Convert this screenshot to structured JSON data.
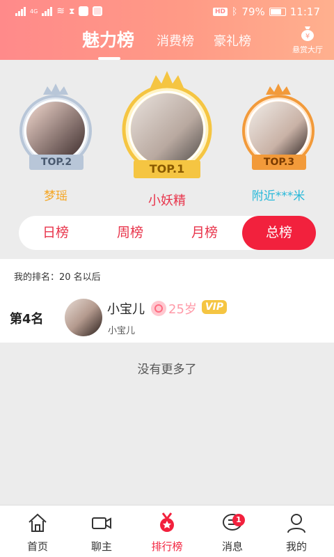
{
  "status_bar": {
    "network": "4G",
    "battery": "79%",
    "time": "11:17",
    "hd": "HD"
  },
  "header": {
    "tabs": [
      {
        "label": "魅力榜",
        "active": true
      },
      {
        "label": "消费榜",
        "active": false
      },
      {
        "label": "豪礼榜",
        "active": false
      }
    ],
    "reward_hall": "悬赏大厅"
  },
  "podium": [
    {
      "rank_label": "TOP.2",
      "name": "梦瑶",
      "name_color": "#f5a623"
    },
    {
      "rank_label": "TOP.1",
      "name": "小妖精",
      "name_color": "#e8334a"
    },
    {
      "rank_label": "TOP.3",
      "name": "附近***米",
      "name_color": "#27b8d9"
    }
  ],
  "period_tabs": [
    {
      "label": "日榜",
      "active": false
    },
    {
      "label": "周榜",
      "active": false
    },
    {
      "label": "月榜",
      "active": false
    },
    {
      "label": "总榜",
      "active": true
    }
  ],
  "my_rank": "我的排名：20 名以后",
  "list": [
    {
      "rank": "第4名",
      "name": "小宝儿",
      "age": "25岁",
      "vip": "VIP",
      "subtitle": "小宝儿"
    }
  ],
  "no_more": "没有更多了",
  "bottom_nav": [
    {
      "label": "首页",
      "icon": "home-icon",
      "active": false
    },
    {
      "label": "聊主",
      "icon": "video-icon",
      "active": false
    },
    {
      "label": "排行榜",
      "icon": "medal-icon",
      "active": true
    },
    {
      "label": "消息",
      "icon": "message-icon",
      "active": false,
      "badge": "1"
    },
    {
      "label": "我的",
      "icon": "profile-icon",
      "active": false
    }
  ],
  "colors": {
    "accent": "#f2213d",
    "gold": "#f5c542",
    "silver": "#b8c6d8",
    "bronze": "#f29a3a"
  }
}
